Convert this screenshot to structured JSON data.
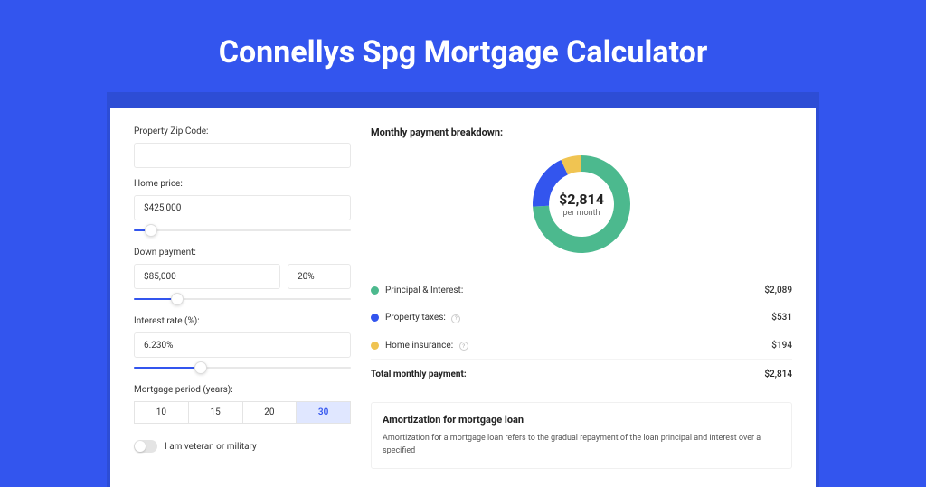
{
  "page_title": "Connellys Spg Mortgage Calculator",
  "form": {
    "zip_label": "Property Zip Code:",
    "zip_value": "",
    "price_label": "Home price:",
    "price_value": "$425,000",
    "price_slider_pct": 8,
    "down_label": "Down payment:",
    "down_value": "$85,000",
    "down_pct": "20%",
    "down_slider_pct": 20,
    "rate_label": "Interest rate (%):",
    "rate_value": "6.230%",
    "rate_slider_pct": 31,
    "period_label": "Mortgage period (years):",
    "periods": [
      "10",
      "15",
      "20",
      "30"
    ],
    "period_active": "30",
    "veteran_label": "I am veteran or military",
    "veteran_on": false
  },
  "breakdown": {
    "title": "Monthly payment breakdown:",
    "total": "$2,814",
    "total_sub": "per month",
    "rows": [
      {
        "dot": "g",
        "label": "Principal & Interest:",
        "info": false,
        "value": "$2,089"
      },
      {
        "dot": "b",
        "label": "Property taxes:",
        "info": true,
        "value": "$531"
      },
      {
        "dot": "y",
        "label": "Home insurance:",
        "info": true,
        "value": "$194"
      }
    ],
    "total_label": "Total monthly payment:",
    "total_value": "$2,814"
  },
  "chart_data": {
    "type": "pie",
    "title": "Monthly payment breakdown",
    "categories": [
      "Principal & Interest",
      "Property taxes",
      "Home insurance"
    ],
    "values": [
      2089,
      531,
      194
    ],
    "colors": [
      "#4cb98e",
      "#3355ee",
      "#f0c452"
    ],
    "center_label": "$2,814",
    "center_sub": "per month"
  },
  "amort": {
    "title": "Amortization for mortgage loan",
    "text": "Amortization for a mortgage loan refers to the gradual repayment of the loan principal and interest over a specified"
  }
}
